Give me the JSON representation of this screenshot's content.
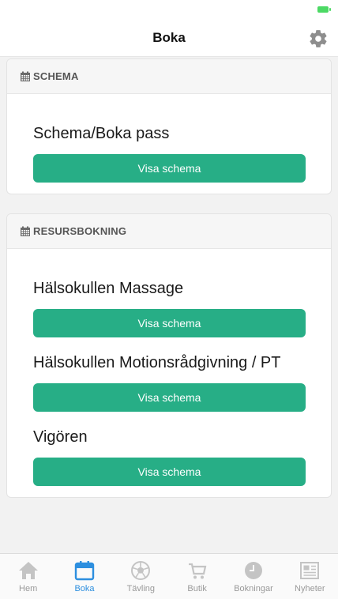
{
  "header": {
    "title": "Boka"
  },
  "schema_section": {
    "header_label": "SCHEMA",
    "items": [
      {
        "title": "Schema/Boka pass",
        "button_label": "Visa schema"
      }
    ]
  },
  "resource_section": {
    "header_label": "RESURSBOKNING",
    "items": [
      {
        "title": "Hälsokullen Massage",
        "button_label": "Visa schema"
      },
      {
        "title": "Hälsokullen Motionsrådgivning / PT",
        "button_label": "Visa schema"
      },
      {
        "title": "Vigören",
        "button_label": "Visa schema"
      }
    ]
  },
  "tabs": [
    {
      "label": "Hem",
      "icon": "home-icon",
      "active": false
    },
    {
      "label": "Boka",
      "icon": "calendar-icon",
      "active": true
    },
    {
      "label": "Tävling",
      "icon": "ball-icon",
      "active": false
    },
    {
      "label": "Butik",
      "icon": "cart-icon",
      "active": false
    },
    {
      "label": "Bokningar",
      "icon": "clock-icon",
      "active": false
    },
    {
      "label": "Nyheter",
      "icon": "newspaper-icon",
      "active": false
    }
  ],
  "colors": {
    "accent_button": "#27ae86",
    "active_tab": "#2d8fdf",
    "inactive_tab": "#bdbdbd",
    "battery": "#4cd964"
  }
}
